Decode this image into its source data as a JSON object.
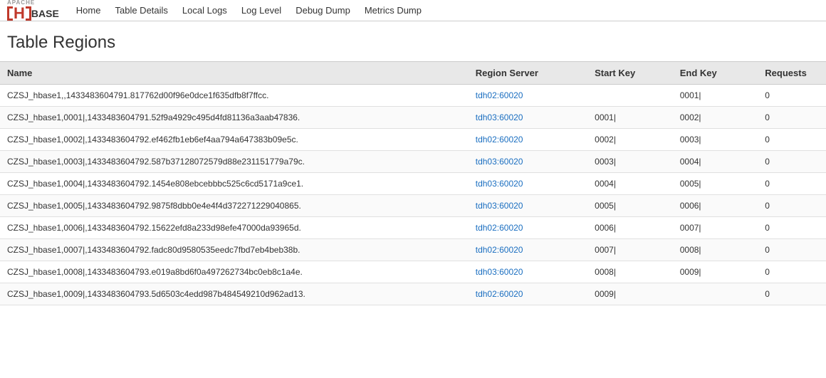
{
  "nav": {
    "links": [
      {
        "label": "Home",
        "href": "#"
      },
      {
        "label": "Table Details",
        "href": "#"
      },
      {
        "label": "Local Logs",
        "href": "#"
      },
      {
        "label": "Log Level",
        "href": "#"
      },
      {
        "label": "Debug Dump",
        "href": "#"
      },
      {
        "label": "Metrics Dump",
        "href": "#"
      }
    ]
  },
  "page": {
    "title": "Table Regions"
  },
  "table": {
    "headers": [
      "Name",
      "Region Server",
      "Start Key",
      "End Key",
      "Requests"
    ],
    "rows": [
      {
        "name": "CZSJ_hbase1,,1433483604791.817762d00f96e0dce1f635dfb8f7ffcc.",
        "server": "tdh02:60020",
        "startKey": "",
        "endKey": "0001|",
        "requests": "0"
      },
      {
        "name": "CZSJ_hbase1,0001|,1433483604791.52f9a4929c495d4fd81136a3aab47836.",
        "server": "tdh03:60020",
        "startKey": "0001|",
        "endKey": "0002|",
        "requests": "0"
      },
      {
        "name": "CZSJ_hbase1,0002|,1433483604792.ef462fb1eb6ef4aa794a647383b09e5c.",
        "server": "tdh02:60020",
        "startKey": "0002|",
        "endKey": "0003|",
        "requests": "0"
      },
      {
        "name": "CZSJ_hbase1,0003|,1433483604792.587b37128072579d88e231151779a79c.",
        "server": "tdh03:60020",
        "startKey": "0003|",
        "endKey": "0004|",
        "requests": "0"
      },
      {
        "name": "CZSJ_hbase1,0004|,1433483604792.1454e808ebcebbbc525c6cd5171a9ce1.",
        "server": "tdh03:60020",
        "startKey": "0004|",
        "endKey": "0005|",
        "requests": "0"
      },
      {
        "name": "CZSJ_hbase1,0005|,1433483604792.9875f8dbb0e4e4f4d372271229040865.",
        "server": "tdh03:60020",
        "startKey": "0005|",
        "endKey": "0006|",
        "requests": "0"
      },
      {
        "name": "CZSJ_hbase1,0006|,1433483604792.15622efd8a233d98efe47000da93965d.",
        "server": "tdh02:60020",
        "startKey": "0006|",
        "endKey": "0007|",
        "requests": "0"
      },
      {
        "name": "CZSJ_hbase1,0007|,1433483604792.fadc80d9580535eedc7fbd7eb4beb38b.",
        "server": "tdh02:60020",
        "startKey": "0007|",
        "endKey": "0008|",
        "requests": "0"
      },
      {
        "name": "CZSJ_hbase1,0008|,1433483604793.e019a8bd6f0a497262734bc0eb8c1a4e.",
        "server": "tdh03:60020",
        "startKey": "0008|",
        "endKey": "0009|",
        "requests": "0"
      },
      {
        "name": "CZSJ_hbase1,0009|,1433483604793.5d6503c4edd987b484549210d962ad13.",
        "server": "tdh02:60020",
        "startKey": "0009|",
        "endKey": "",
        "requests": "0"
      }
    ]
  }
}
